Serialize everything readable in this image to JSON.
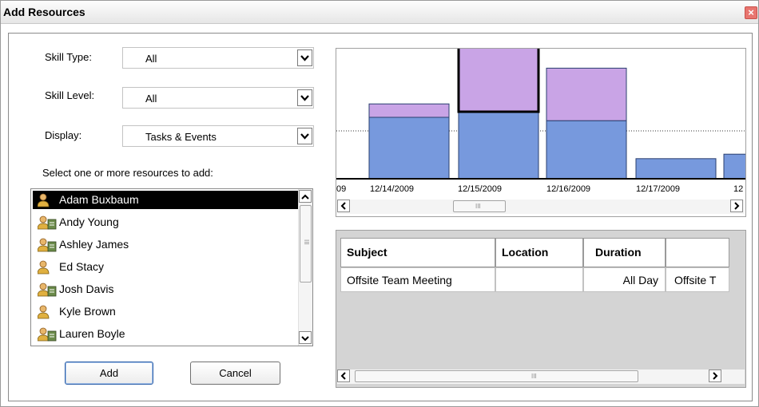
{
  "dialog": {
    "title": "Add Resources",
    "close_glyph": "×"
  },
  "filters": {
    "skill_type": {
      "label": "Skill Type:",
      "value": "All"
    },
    "skill_level": {
      "label": "Skill Level:",
      "value": "All"
    },
    "display": {
      "label": "Display:",
      "value": "Tasks & Events"
    }
  },
  "resources": {
    "prompt": "Select one or more resources to add:",
    "items": [
      {
        "name": "Adam Buxbaum",
        "icon": "person-icon",
        "selected": true
      },
      {
        "name": "Andy Young",
        "icon": "person-card-icon",
        "selected": false
      },
      {
        "name": "Ashley James",
        "icon": "person-card-icon",
        "selected": false
      },
      {
        "name": "Ed Stacy",
        "icon": "person-icon",
        "selected": false
      },
      {
        "name": "Josh Davis",
        "icon": "person-card-icon",
        "selected": false
      },
      {
        "name": "Kyle Brown",
        "icon": "person-icon",
        "selected": false
      },
      {
        "name": "Lauren Boyle",
        "icon": "person-card-icon",
        "selected": false
      }
    ]
  },
  "buttons": {
    "add": "Add",
    "cancel": "Cancel"
  },
  "chart_data": {
    "type": "bar",
    "categories": [
      "09",
      "12/14/2009",
      "12/15/2009",
      "12/16/2009",
      "12/17/2009",
      "12"
    ],
    "series": [
      {
        "values": [
          null,
          0.55,
          0.6,
          0.52,
          0.18,
          0.22
        ]
      },
      {
        "values": [
          null,
          0.12,
          0.64,
          0.47,
          0,
          0
        ]
      }
    ],
    "threshold_line": "dotted",
    "colors": {
      "lower": "#7799dd",
      "upper": "#c9a4e6",
      "selected_outline": "#000000"
    },
    "selected_category": "12/15/2009"
  },
  "grid": {
    "columns": [
      "Subject",
      "Location",
      "Duration",
      ""
    ],
    "rows": [
      {
        "subject": "Offsite Team Meeting",
        "location": "",
        "duration": "All Day",
        "extra": "Offsite T"
      }
    ]
  },
  "scroll": {
    "grip": "III"
  }
}
